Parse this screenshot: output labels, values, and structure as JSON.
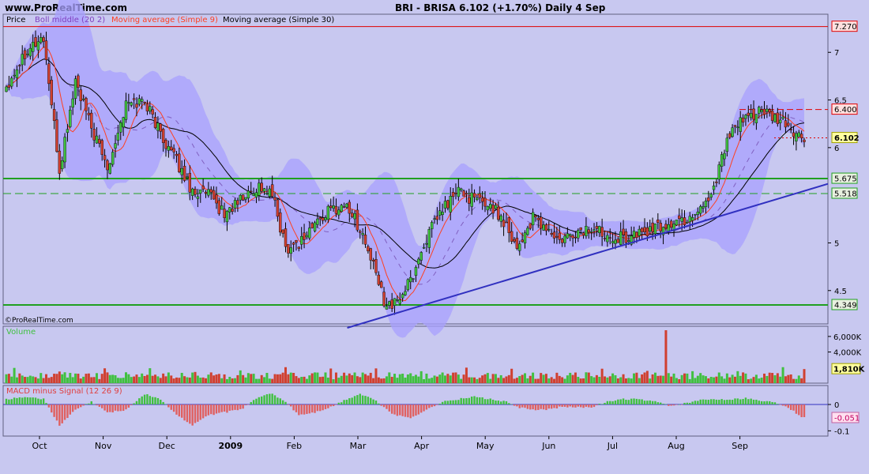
{
  "header": {
    "site": "www.ProRealTime.com",
    "title": "BRI - BRISA     6.102 (+1.70%)     Daily  4 Sep",
    "copyright": "©ProRealTime.com"
  },
  "legend": {
    "price": "Price",
    "boll": "Boll middle (20 2)",
    "ma9": "Moving average (Simple 9)",
    "ma30": "Moving average (Simple 30)"
  },
  "colors": {
    "bg": "#c8c8f0",
    "band": "#a8a0ff",
    "up": "#40c040",
    "down": "#d04030",
    "ma9": "#ff4020",
    "ma30": "#000000",
    "boll": "#8060c0",
    "hline_green": "#20a020",
    "resistance_red": "#e00000",
    "trendline": "#3030c0"
  },
  "chart_data": [
    {
      "type": "candlestick",
      "title": "BRI - BRISA     6.102 (+1.70%)     Daily  4 Sep",
      "ylim": [
        4.15,
        7.4
      ],
      "y_ticks": [
        "7",
        "6.5",
        "6",
        "5",
        "4.5"
      ],
      "x_labels": [
        "Oct",
        "Nov",
        "Dec",
        "2009",
        "Feb",
        "Mar",
        "Apr",
        "May",
        "Jun",
        "Jul",
        "Aug",
        "Sep"
      ],
      "price_anchors": [
        [
          0,
          6.65
        ],
        [
          8,
          7.05
        ],
        [
          14,
          7.15
        ],
        [
          20,
          5.75
        ],
        [
          26,
          6.7
        ],
        [
          32,
          6.2
        ],
        [
          38,
          5.8
        ],
        [
          45,
          6.45
        ],
        [
          52,
          6.5
        ],
        [
          58,
          6.15
        ],
        [
          63,
          5.9
        ],
        [
          70,
          5.55
        ],
        [
          76,
          5.5
        ],
        [
          82,
          5.3
        ],
        [
          88,
          5.45
        ],
        [
          95,
          5.6
        ],
        [
          100,
          5.5
        ],
        [
          105,
          4.95
        ],
        [
          110,
          5.0
        ],
        [
          116,
          5.2
        ],
        [
          122,
          5.35
        ],
        [
          128,
          5.4
        ],
        [
          133,
          5.15
        ],
        [
          138,
          4.75
        ],
        [
          142,
          4.4
        ],
        [
          146,
          4.35
        ],
        [
          152,
          4.6
        ],
        [
          158,
          5.05
        ],
        [
          164,
          5.35
        ],
        [
          170,
          5.55
        ],
        [
          176,
          5.45
        ],
        [
          182,
          5.4
        ],
        [
          188,
          5.2
        ],
        [
          192,
          4.95
        ],
        [
          198,
          5.25
        ],
        [
          203,
          5.15
        ],
        [
          208,
          5.0
        ],
        [
          214,
          5.1
        ],
        [
          220,
          5.15
        ],
        [
          226,
          5.1
        ],
        [
          232,
          5.05
        ],
        [
          238,
          5.1
        ],
        [
          244,
          5.15
        ],
        [
          250,
          5.2
        ],
        [
          256,
          5.25
        ],
        [
          260,
          5.35
        ],
        [
          265,
          5.5
        ],
        [
          270,
          6.0
        ],
        [
          274,
          6.2
        ],
        [
          278,
          6.3
        ],
        [
          283,
          6.4
        ],
        [
          288,
          6.3
        ],
        [
          293,
          6.25
        ],
        [
          298,
          6.1
        ],
        [
          300,
          6.1
        ]
      ],
      "price_labels": [
        {
          "value": 7.27,
          "text": "7.270",
          "style": "resistance"
        },
        {
          "value": 6.4,
          "text": "6.400",
          "style": "resistance"
        },
        {
          "value": 6.102,
          "text": "6.102",
          "style": "current"
        },
        {
          "value": 5.675,
          "text": "5.675",
          "style": "support"
        },
        {
          "value": 5.518,
          "text": "5.518",
          "style": "support"
        },
        {
          "value": 4.349,
          "text": "4.349",
          "style": "support"
        }
      ],
      "trendline": {
        "from": [
          146,
          4.15
        ],
        "to": [
          300,
          5.62
        ]
      }
    },
    {
      "type": "bar",
      "title": "Volume",
      "y_ticks": [
        "6,000K",
        "4,000K"
      ],
      "current_label": "1,810K",
      "ylim": [
        0,
        6800
      ],
      "spike": {
        "index": 248,
        "value": 6800
      }
    },
    {
      "type": "bar",
      "title": "MACD minus Signal (12 26 9)",
      "y_ticks": [
        "0",
        "-0.1"
      ],
      "current_label": "-0.051",
      "ylim": [
        -0.12,
        0.06
      ],
      "hist_anchors": [
        [
          0,
          0.02
        ],
        [
          8,
          0.03
        ],
        [
          14,
          0.02
        ],
        [
          20,
          -0.08
        ],
        [
          26,
          -0.02
        ],
        [
          32,
          0.01
        ],
        [
          38,
          -0.03
        ],
        [
          45,
          -0.02
        ],
        [
          52,
          0.04
        ],
        [
          58,
          0.02
        ],
        [
          63,
          -0.03
        ],
        [
          70,
          -0.08
        ],
        [
          76,
          -0.04
        ],
        [
          82,
          -0.03
        ],
        [
          88,
          -0.02
        ],
        [
          95,
          0.03
        ],
        [
          100,
          0.04
        ],
        [
          105,
          0.01
        ],
        [
          110,
          -0.04
        ],
        [
          116,
          -0.03
        ],
        [
          122,
          -0.01
        ],
        [
          128,
          0.02
        ],
        [
          133,
          0.04
        ],
        [
          138,
          0.02
        ],
        [
          142,
          -0.01
        ],
        [
          146,
          -0.04
        ],
        [
          152,
          -0.05
        ],
        [
          158,
          -0.02
        ],
        [
          164,
          0.01
        ],
        [
          170,
          0.02
        ],
        [
          176,
          0.03
        ],
        [
          182,
          0.02
        ],
        [
          188,
          0.01
        ],
        [
          192,
          -0.01
        ],
        [
          198,
          -0.02
        ],
        [
          203,
          -0.02
        ],
        [
          208,
          -0.01
        ],
        [
          214,
          -0.01
        ],
        [
          220,
          -0.01
        ],
        [
          226,
          0.01
        ],
        [
          232,
          0.02
        ],
        [
          238,
          0.02
        ],
        [
          244,
          0.01
        ],
        [
          250,
          -0.005
        ],
        [
          256,
          0.005
        ],
        [
          260,
          0.015
        ],
        [
          265,
          0.02
        ],
        [
          270,
          0.02
        ],
        [
          274,
          0.02
        ],
        [
          278,
          0.025
        ],
        [
          283,
          0.015
        ],
        [
          288,
          0.01
        ],
        [
          293,
          -0.005
        ],
        [
          298,
          -0.04
        ],
        [
          300,
          -0.051
        ]
      ]
    }
  ]
}
